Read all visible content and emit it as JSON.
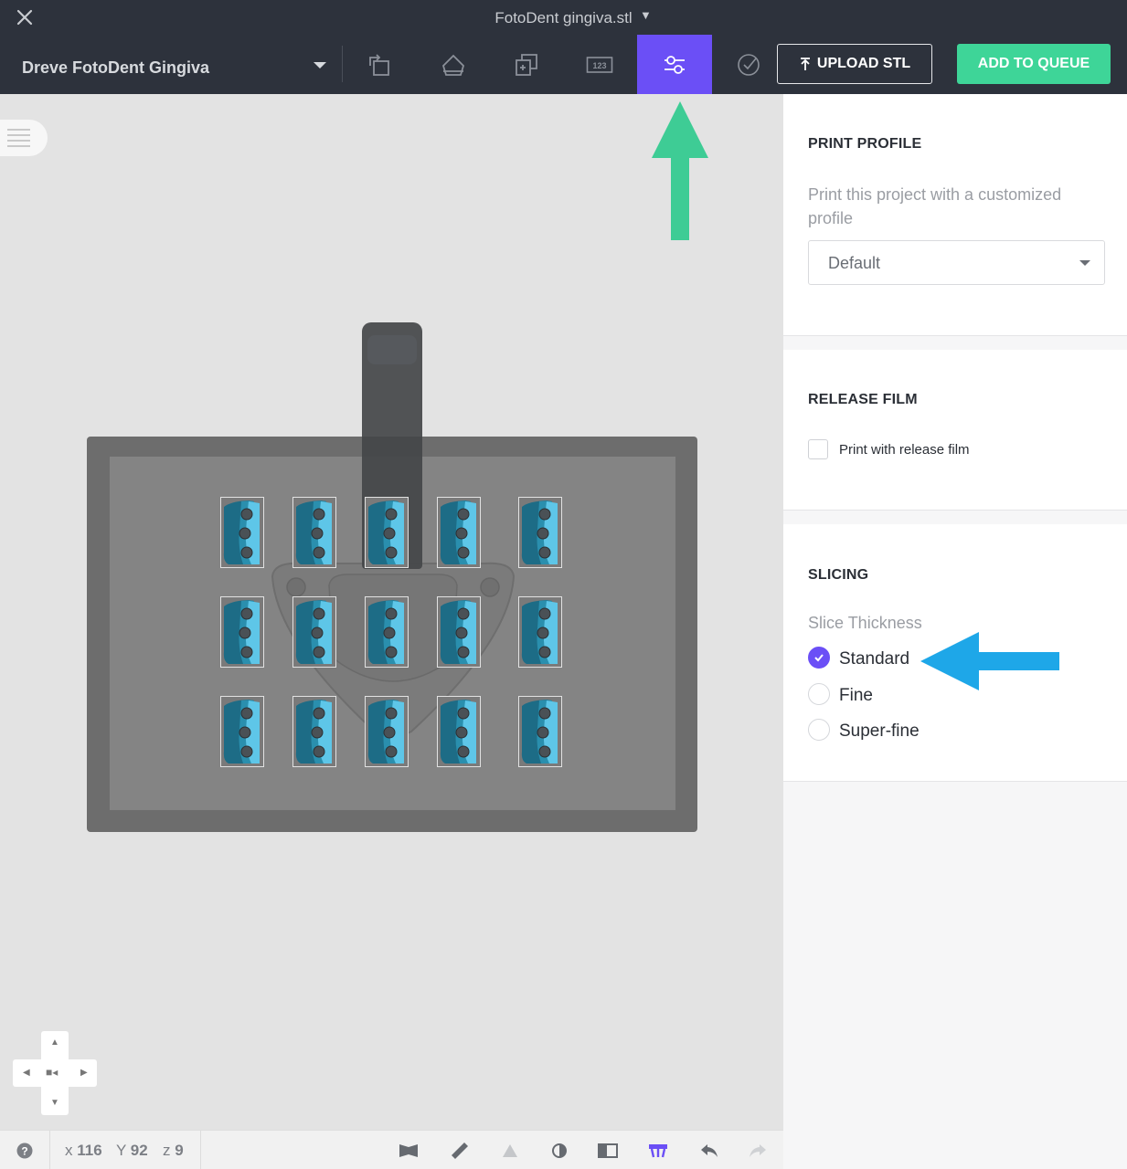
{
  "window": {
    "title": "FotoDent gingiva.stl",
    "title_caret": "▼"
  },
  "toolbar": {
    "material": "Dreve FotoDent Gingiva",
    "tools": [
      {
        "name": "orient-tool",
        "active": false
      },
      {
        "name": "support-tool",
        "active": false
      },
      {
        "name": "arrange-tool",
        "active": false
      },
      {
        "name": "label-tool",
        "icon_text": "123",
        "active": false
      },
      {
        "name": "print-settings-tool",
        "active": true
      },
      {
        "name": "validate-tool",
        "active": false
      }
    ],
    "upload_label": "UPLOAD STL",
    "queue_label": "ADD TO QUEUE",
    "accent_color": "#6b4ff6",
    "queue_color": "#3ed598"
  },
  "viewport": {
    "parts_grid": {
      "rows": 3,
      "cols": 5
    },
    "annotation_arrow_color": "#3ecc95"
  },
  "panel": {
    "print_profile": {
      "title": "PRINT PROFILE",
      "description": "Print this project with a customized profile",
      "selected": "Default"
    },
    "release_film": {
      "title": "RELEASE FILM",
      "checkbox_label": "Print with release film",
      "checked": false
    },
    "slicing": {
      "title": "SLICING",
      "subtitle": "Slice Thickness",
      "options": [
        {
          "label": "Standard",
          "checked": true
        },
        {
          "label": "Fine",
          "checked": false
        },
        {
          "label": "Super-fine",
          "checked": false
        }
      ],
      "annotation_arrow_color": "#1ea7e8"
    }
  },
  "statusbar": {
    "help_icon": "?",
    "x_label": "x",
    "x_value": "116",
    "y_label": "Y",
    "y_value": "92",
    "z_label": "z",
    "z_value": "9"
  }
}
